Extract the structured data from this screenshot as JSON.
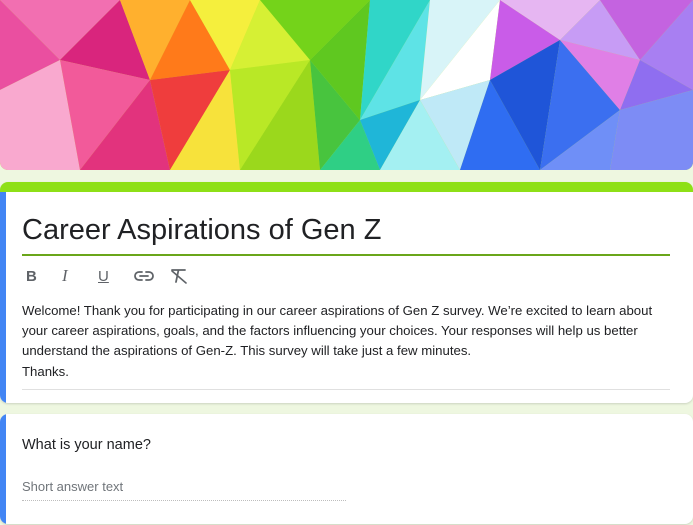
{
  "form": {
    "title": "Career Aspirations of Gen Z",
    "toolbar": {
      "bold": "B",
      "italic": "I",
      "underline": "U",
      "link_icon": "link-icon",
      "clear_format_icon": "clear-formatting-icon"
    },
    "description": [
      " Welcome! Thank you for participating in our career aspirations of Gen Z survey. We’re excited to learn about",
      "your career aspirations, goals, and the factors influencing your choices. Your responses will help us better",
      "understand the aspirations of Gen-Z. This survey will take just a few minutes.",
      "Thanks."
    ]
  },
  "question": {
    "title": "What is your name?",
    "answer_placeholder": "Short answer text"
  },
  "colors": {
    "theme_accent": "#8ee016",
    "focus_accent": "#4285f4",
    "page_background": "#eef7e0"
  }
}
